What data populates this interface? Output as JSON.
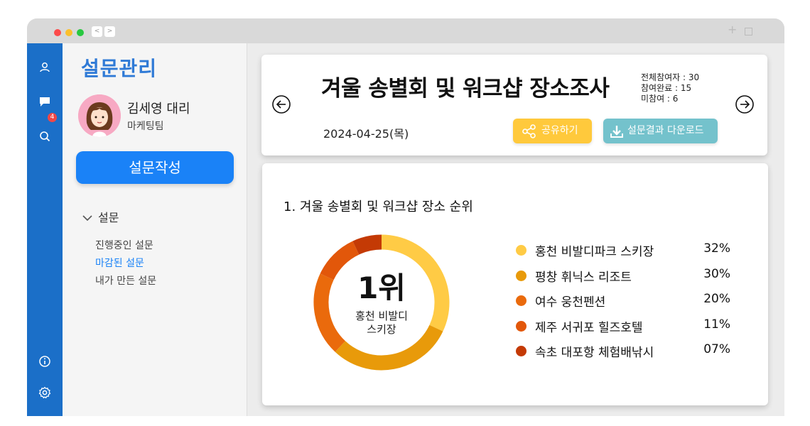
{
  "window": {
    "nav_back": "<",
    "nav_forward": ">",
    "new_tab": "+"
  },
  "rail": {
    "notification_count": "4",
    "icons": [
      "user-icon",
      "chat-icon",
      "search-icon",
      "info-icon",
      "settings-icon"
    ]
  },
  "sidebar": {
    "app_title": "설문관리",
    "user": {
      "name": "김세영 대리",
      "team": "마케팅팀"
    },
    "create_button": "설문작성",
    "section": "설문",
    "items": [
      {
        "label": "진행중인 설문",
        "active": false
      },
      {
        "label": "마감된 설문",
        "active": true
      },
      {
        "label": "내가 만든 설문",
        "active": false
      }
    ]
  },
  "survey": {
    "title": "겨울 송별회 및 워크샵 장소조사",
    "date": "2024-04-25(목)",
    "stats": {
      "total": "전체참여자 : 30",
      "completed": "참여완료 : 15",
      "not_participated": "미참여 : 6"
    },
    "share_label": "공유하기",
    "download_label": "설문결과 다운로드"
  },
  "question": {
    "title": "1. 겨울 송별회 및 워크샵 장소 순위",
    "rank": "1위",
    "top_choice": "홍천 비발디\n스키장"
  },
  "colors": {
    "accent": "#1a82f7",
    "rail": "#1b6fc8",
    "share": "#ffc93c",
    "download": "#74c2cc"
  },
  "chart_data": {
    "type": "pie",
    "categories": [
      "홍천 비발디파크 스키장",
      "평창 휘닉스 리조트",
      "여수 웅천펜션",
      "제주 서귀포 힐즈호텔",
      "속초 대포항 체험배낚시"
    ],
    "values": [
      32,
      30,
      20,
      11,
      7
    ],
    "value_labels": [
      "32%",
      "30%",
      "20%",
      "11%",
      "07%"
    ],
    "colors": [
      "#ffcb45",
      "#e89a0a",
      "#ea6a0c",
      "#e2570a",
      "#c43a05"
    ],
    "legend": "right"
  }
}
